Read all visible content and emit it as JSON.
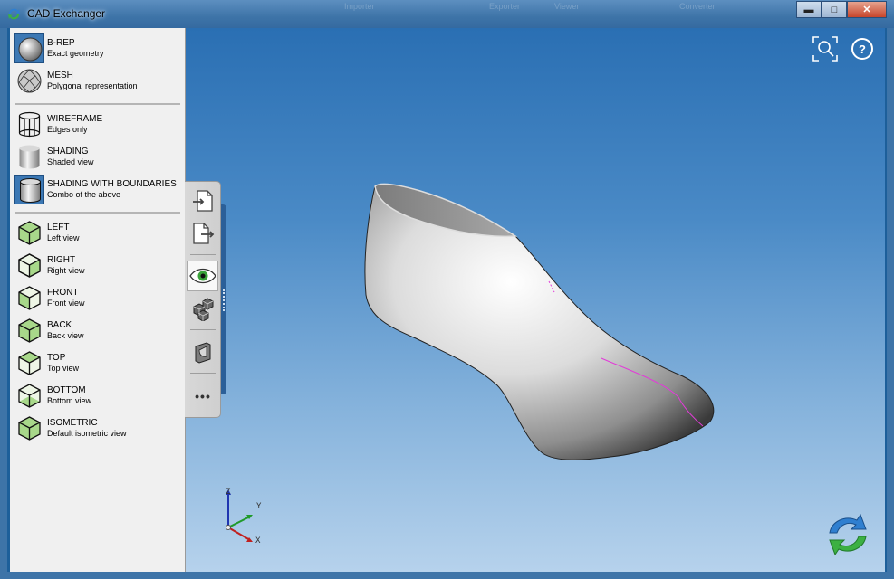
{
  "window": {
    "title": "CAD Exchanger",
    "ghost_labels": [
      "Importer",
      "Exporter",
      "Viewer",
      "Converter"
    ],
    "buttons": {
      "minimize": "▬",
      "maximize": "□",
      "close": "✕"
    }
  },
  "sidebar": {
    "groups": [
      [
        {
          "label": "B-REP",
          "sub": "Exact geometry",
          "icon": "sphere-icon",
          "selected": true
        },
        {
          "label": "MESH",
          "sub": "Polygonal representation",
          "icon": "mesh-sphere-icon",
          "selected": false
        }
      ],
      [
        {
          "label": "WIREFRAME",
          "sub": "Edges only",
          "icon": "wireframe-cylinder-icon",
          "selected": false
        },
        {
          "label": "SHADING",
          "sub": "Shaded view",
          "icon": "shaded-cylinder-icon",
          "selected": false
        },
        {
          "label": "SHADING WITH BOUNDARIES",
          "sub": "Combo of the above",
          "icon": "shaded-boundaries-cylinder-icon",
          "selected": true
        }
      ],
      [
        {
          "label": "LEFT",
          "sub": "Left view",
          "icon": "cube-left-icon"
        },
        {
          "label": "RIGHT",
          "sub": "Right view",
          "icon": "cube-right-icon"
        },
        {
          "label": "FRONT",
          "sub": "Front view",
          "icon": "cube-front-icon"
        },
        {
          "label": "BACK",
          "sub": "Back view",
          "icon": "cube-back-icon"
        },
        {
          "label": "TOP",
          "sub": "Top view",
          "icon": "cube-top-icon"
        },
        {
          "label": "BOTTOM",
          "sub": "Bottom view",
          "icon": "cube-bottom-icon"
        },
        {
          "label": "ISOMETRIC",
          "sub": "Default isometric view",
          "icon": "cube-isometric-icon"
        }
      ]
    ]
  },
  "toolstrip": {
    "buttons": [
      {
        "name": "import-icon"
      },
      {
        "name": "export-icon"
      },
      {
        "name": "eye-icon",
        "active": true
      },
      {
        "name": "assembly-cubes-icon"
      },
      {
        "name": "section-icon"
      },
      {
        "name": "more-dots-icon"
      }
    ],
    "more_label": "•••"
  },
  "viewport": {
    "tools": [
      "zoom-fit-icon",
      "help-icon"
    ],
    "help_label": "?",
    "axes": {
      "x": "X",
      "y": "Y",
      "z": "Z"
    },
    "colors": {
      "x_axis": "#c0201f",
      "y_axis": "#1f9a2a",
      "z_axis": "#1f35b0",
      "model_boundary": "#e23bd8"
    }
  }
}
